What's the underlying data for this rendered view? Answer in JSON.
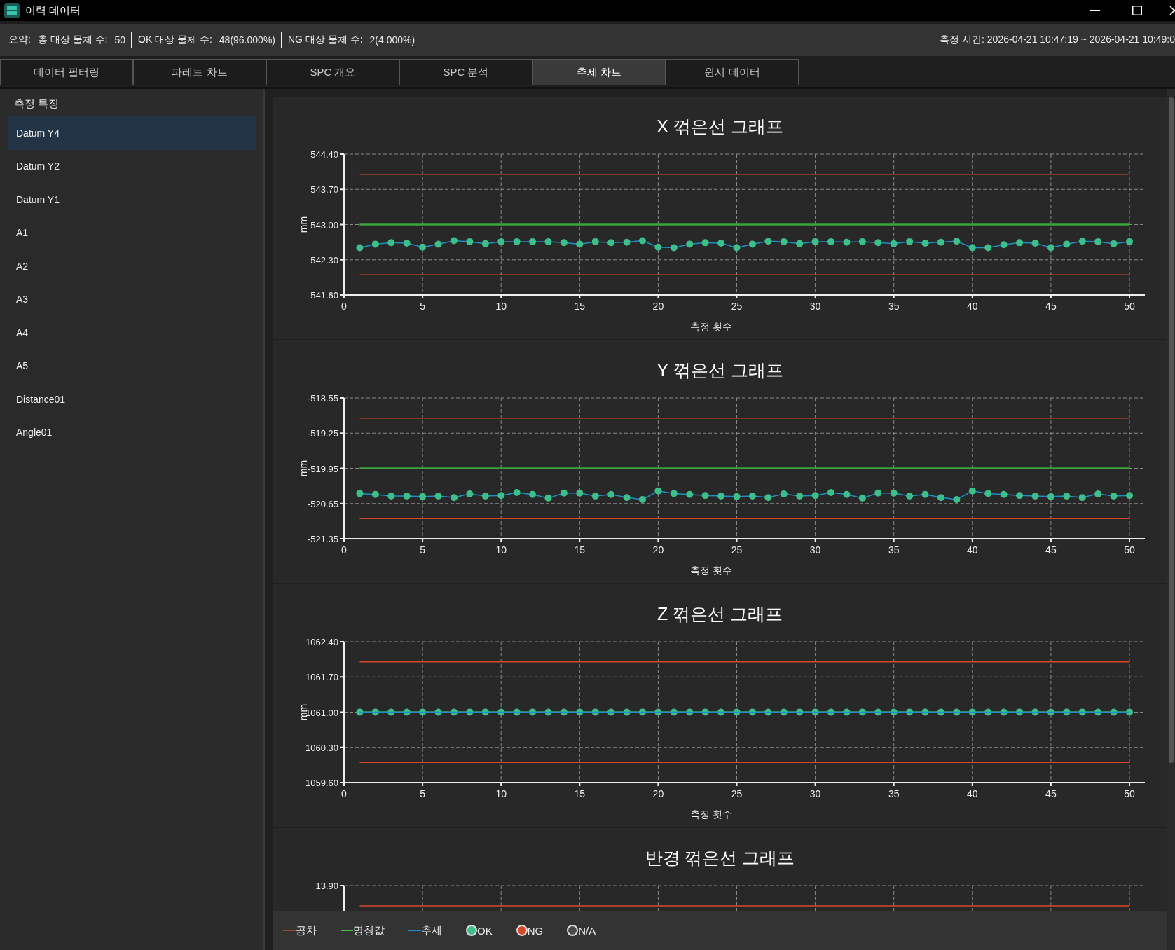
{
  "window": {
    "title": "이력 데이터"
  },
  "summary": {
    "label": "요약:",
    "stats": [
      {
        "label": "총 대상 물체 수:",
        "value": "50"
      },
      {
        "label": "OK 대상 물체 수:",
        "value": "48(96.000%)"
      },
      {
        "label": "NG 대상 물체 수:",
        "value": "2(4.000%)"
      }
    ],
    "time": "측정 시간: 2026-04-21 10:47:19 ~ 2026-04-21 10:49:0"
  },
  "tabs": [
    {
      "label": "데이터 필터링",
      "selected": false
    },
    {
      "label": "파레토 차트",
      "selected": false
    },
    {
      "label": "SPC 개요",
      "selected": false
    },
    {
      "label": "SPC 분석",
      "selected": false
    },
    {
      "label": "추세 차트",
      "selected": true
    },
    {
      "label": "원시 데이터",
      "selected": false
    }
  ],
  "sidebar": {
    "header": "측정 특징",
    "items": [
      {
        "label": "Datum Y4",
        "selected": true
      },
      {
        "label": "Datum Y2",
        "selected": false
      },
      {
        "label": "Datum Y1",
        "selected": false
      },
      {
        "label": "A1",
        "selected": false
      },
      {
        "label": "A2",
        "selected": false
      },
      {
        "label": "A3",
        "selected": false
      },
      {
        "label": "A4",
        "selected": false
      },
      {
        "label": "A5",
        "selected": false
      },
      {
        "label": "Distance01",
        "selected": false
      },
      {
        "label": "Angle01",
        "selected": false
      }
    ]
  },
  "charts": [
    {
      "chart_data": {
        "type": "line",
        "grid": true,
        "title": "X 꺾은선 그래프",
        "xlabel": "측정 횟수",
        "ylabel": "mm",
        "xlim": [
          0,
          50
        ],
        "ylim": [
          541.6,
          544.4
        ],
        "xticks": [
          0,
          5,
          10,
          15,
          20,
          25,
          30,
          35,
          40,
          45,
          50
        ],
        "yticks": [
          {
            "value": 541.6,
            "label": "541.60"
          },
          {
            "value": 542.3,
            "label": "542.30"
          },
          {
            "value": 543.0,
            "label": "543.00"
          },
          {
            "value": 543.7,
            "label": "543.70"
          },
          {
            "value": 544.4,
            "label": "544.40"
          }
        ],
        "x": [
          1,
          2,
          3,
          4,
          5,
          6,
          7,
          8,
          9,
          10,
          11,
          12,
          13,
          14,
          15,
          16,
          17,
          18,
          19,
          20,
          21,
          22,
          23,
          24,
          25,
          26,
          27,
          28,
          29,
          30,
          31,
          32,
          33,
          34,
          35,
          36,
          37,
          38,
          39,
          40,
          41,
          42,
          43,
          44,
          45,
          46,
          47,
          48,
          49,
          50
        ],
        "series": [
          {
            "color": "#d9472b",
            "values": [
              544.0,
              544.0,
              544.0,
              544.0,
              544.0,
              544.0,
              544.0,
              544.0,
              544.0,
              544.0,
              544.0,
              544.0,
              544.0,
              544.0,
              544.0,
              544.0,
              544.0,
              544.0,
              544.0,
              544.0,
              544.0,
              544.0,
              544.0,
              544.0,
              544.0,
              544.0,
              544.0,
              544.0,
              544.0,
              544.0,
              544.0,
              544.0,
              544.0,
              544.0,
              544.0,
              544.0,
              544.0,
              544.0,
              544.0,
              544.0,
              544.0,
              544.0,
              544.0,
              544.0,
              544.0,
              544.0,
              544.0,
              544.0,
              544.0,
              544.0
            ]
          },
          {
            "color": "#d9472b",
            "values": [
              542.0,
              542.0,
              542.0,
              542.0,
              542.0,
              542.0,
              542.0,
              542.0,
              542.0,
              542.0,
              542.0,
              542.0,
              542.0,
              542.0,
              542.0,
              542.0,
              542.0,
              542.0,
              542.0,
              542.0,
              542.0,
              542.0,
              542.0,
              542.0,
              542.0,
              542.0,
              542.0,
              542.0,
              542.0,
              542.0,
              542.0,
              542.0,
              542.0,
              542.0,
              542.0,
              542.0,
              542.0,
              542.0,
              542.0,
              542.0,
              542.0,
              542.0,
              542.0,
              542.0,
              542.0,
              542.0,
              542.0,
              542.0,
              542.0,
              542.0
            ]
          },
          {
            "color": "#3aa63a",
            "values": [
              543.0,
              543.0,
              543.0,
              543.0,
              543.0,
              543.0,
              543.0,
              543.0,
              543.0,
              543.0,
              543.0,
              543.0,
              543.0,
              543.0,
              543.0,
              543.0,
              543.0,
              543.0,
              543.0,
              543.0,
              543.0,
              543.0,
              543.0,
              543.0,
              543.0,
              543.0,
              543.0,
              543.0,
              543.0,
              543.0,
              543.0,
              543.0,
              543.0,
              543.0,
              543.0,
              543.0,
              543.0,
              543.0,
              543.0,
              543.0,
              543.0,
              543.0,
              543.0,
              543.0,
              543.0,
              543.0,
              543.0,
              543.0,
              543.0,
              543.0
            ]
          },
          {
            "color": "#1f8fc8",
            "marker": "circle",
            "values": [
              542.54,
              542.61,
              542.64,
              542.63,
              542.55,
              542.61,
              542.68,
              542.66,
              542.62,
              542.66,
              542.66,
              542.66,
              542.66,
              542.64,
              542.61,
              542.66,
              542.64,
              542.65,
              542.68,
              542.55,
              542.54,
              542.61,
              542.64,
              542.63,
              542.54,
              542.61,
              542.67,
              542.66,
              542.62,
              542.66,
              542.66,
              542.65,
              542.66,
              542.64,
              542.62,
              542.66,
              542.63,
              542.65,
              542.67,
              542.54,
              542.54,
              542.6,
              542.64,
              542.63,
              542.54,
              542.61,
              542.67,
              542.66,
              542.62,
              542.66
            ]
          }
        ]
      }
    },
    {
      "chart_data": {
        "type": "line",
        "grid": true,
        "title": "Y 꺾은선 그래프",
        "xlabel": "측정 횟수",
        "ylabel": "mm",
        "xlim": [
          0,
          50
        ],
        "ylim": [
          -521.35,
          -518.55
        ],
        "xticks": [
          0,
          5,
          10,
          15,
          20,
          25,
          30,
          35,
          40,
          45,
          50
        ],
        "yticks": [
          {
            "value": -521.35,
            "label": "-521.35"
          },
          {
            "value": -520.65,
            "label": "-520.65"
          },
          {
            "value": -519.95,
            "label": "-519.95"
          },
          {
            "value": -519.25,
            "label": "-519.25"
          },
          {
            "value": -518.55,
            "label": "-518.55"
          }
        ],
        "x": [
          1,
          2,
          3,
          4,
          5,
          6,
          7,
          8,
          9,
          10,
          11,
          12,
          13,
          14,
          15,
          16,
          17,
          18,
          19,
          20,
          21,
          22,
          23,
          24,
          25,
          26,
          27,
          28,
          29,
          30,
          31,
          32,
          33,
          34,
          35,
          36,
          37,
          38,
          39,
          40,
          41,
          42,
          43,
          44,
          45,
          46,
          47,
          48,
          49,
          50
        ],
        "series": [
          {
            "color": "#d9472b",
            "values": [
              -518.95,
              -518.95,
              -518.95,
              -518.95,
              -518.95,
              -518.95,
              -518.95,
              -518.95,
              -518.95,
              -518.95,
              -518.95,
              -518.95,
              -518.95,
              -518.95,
              -518.95,
              -518.95,
              -518.95,
              -518.95,
              -518.95,
              -518.95,
              -518.95,
              -518.95,
              -518.95,
              -518.95,
              -518.95,
              -518.95,
              -518.95,
              -518.95,
              -518.95,
              -518.95,
              -518.95,
              -518.95,
              -518.95,
              -518.95,
              -518.95,
              -518.95,
              -518.95,
              -518.95,
              -518.95,
              -518.95,
              -518.95,
              -518.95,
              -518.95,
              -518.95,
              -518.95,
              -518.95,
              -518.95,
              -518.95,
              -518.95,
              -518.95
            ]
          },
          {
            "color": "#d9472b",
            "values": [
              -520.95,
              -520.95,
              -520.95,
              -520.95,
              -520.95,
              -520.95,
              -520.95,
              -520.95,
              -520.95,
              -520.95,
              -520.95,
              -520.95,
              -520.95,
              -520.95,
              -520.95,
              -520.95,
              -520.95,
              -520.95,
              -520.95,
              -520.95,
              -520.95,
              -520.95,
              -520.95,
              -520.95,
              -520.95,
              -520.95,
              -520.95,
              -520.95,
              -520.95,
              -520.95,
              -520.95,
              -520.95,
              -520.95,
              -520.95,
              -520.95,
              -520.95,
              -520.95,
              -520.95,
              -520.95,
              -520.95,
              -520.95,
              -520.95,
              -520.95,
              -520.95,
              -520.95,
              -520.95,
              -520.95,
              -520.95,
              -520.95,
              -520.95
            ]
          },
          {
            "color": "#3aa63a",
            "values": [
              -519.95,
              -519.95,
              -519.95,
              -519.95,
              -519.95,
              -519.95,
              -519.95,
              -519.95,
              -519.95,
              -519.95,
              -519.95,
              -519.95,
              -519.95,
              -519.95,
              -519.95,
              -519.95,
              -519.95,
              -519.95,
              -519.95,
              -519.95,
              -519.95,
              -519.95,
              -519.95,
              -519.95,
              -519.95,
              -519.95,
              -519.95,
              -519.95,
              -519.95,
              -519.95,
              -519.95,
              -519.95,
              -519.95,
              -519.95,
              -519.95,
              -519.95,
              -519.95,
              -519.95,
              -519.95,
              -519.95,
              -519.95,
              -519.95,
              -519.95,
              -519.95,
              -519.95,
              -519.95,
              -519.95,
              -519.95,
              -519.95,
              -519.95
            ]
          },
          {
            "color": "#1f8fc8",
            "marker": "circle",
            "values": [
              -520.45,
              -520.47,
              -520.5,
              -520.5,
              -520.51,
              -520.5,
              -520.53,
              -520.46,
              -520.5,
              -520.49,
              -520.43,
              -520.47,
              -520.54,
              -520.44,
              -520.44,
              -520.5,
              -520.47,
              -520.53,
              -520.57,
              -520.4,
              -520.45,
              -520.47,
              -520.49,
              -520.5,
              -520.51,
              -520.5,
              -520.53,
              -520.46,
              -520.5,
              -520.49,
              -520.43,
              -520.47,
              -520.54,
              -520.44,
              -520.44,
              -520.5,
              -520.47,
              -520.53,
              -520.57,
              -520.4,
              -520.45,
              -520.47,
              -520.49,
              -520.5,
              -520.51,
              -520.5,
              -520.53,
              -520.46,
              -520.5,
              -520.49
            ]
          }
        ]
      }
    },
    {
      "chart_data": {
        "type": "line",
        "grid": true,
        "title": "Z 꺾은선 그래프",
        "xlabel": "측정 횟수",
        "ylabel": "mm",
        "xlim": [
          0,
          50
        ],
        "ylim": [
          1059.6,
          1062.4
        ],
        "xticks": [
          0,
          5,
          10,
          15,
          20,
          25,
          30,
          35,
          40,
          45,
          50
        ],
        "yticks": [
          {
            "value": 1059.6,
            "label": "1059.60"
          },
          {
            "value": 1060.3,
            "label": "1060.30"
          },
          {
            "value": 1061.0,
            "label": "1061.00"
          },
          {
            "value": 1061.7,
            "label": "1061.70"
          },
          {
            "value": 1062.4,
            "label": "1062.40"
          }
        ],
        "x": [
          1,
          2,
          3,
          4,
          5,
          6,
          7,
          8,
          9,
          10,
          11,
          12,
          13,
          14,
          15,
          16,
          17,
          18,
          19,
          20,
          21,
          22,
          23,
          24,
          25,
          26,
          27,
          28,
          29,
          30,
          31,
          32,
          33,
          34,
          35,
          36,
          37,
          38,
          39,
          40,
          41,
          42,
          43,
          44,
          45,
          46,
          47,
          48,
          49,
          50
        ],
        "series": [
          {
            "color": "#d9472b",
            "values": [
              1062.0,
              1062.0,
              1062.0,
              1062.0,
              1062.0,
              1062.0,
              1062.0,
              1062.0,
              1062.0,
              1062.0,
              1062.0,
              1062.0,
              1062.0,
              1062.0,
              1062.0,
              1062.0,
              1062.0,
              1062.0,
              1062.0,
              1062.0,
              1062.0,
              1062.0,
              1062.0,
              1062.0,
              1062.0,
              1062.0,
              1062.0,
              1062.0,
              1062.0,
              1062.0,
              1062.0,
              1062.0,
              1062.0,
              1062.0,
              1062.0,
              1062.0,
              1062.0,
              1062.0,
              1062.0,
              1062.0,
              1062.0,
              1062.0,
              1062.0,
              1062.0,
              1062.0,
              1062.0,
              1062.0,
              1062.0,
              1062.0,
              1062.0
            ]
          },
          {
            "color": "#d9472b",
            "values": [
              1060.0,
              1060.0,
              1060.0,
              1060.0,
              1060.0,
              1060.0,
              1060.0,
              1060.0,
              1060.0,
              1060.0,
              1060.0,
              1060.0,
              1060.0,
              1060.0,
              1060.0,
              1060.0,
              1060.0,
              1060.0,
              1060.0,
              1060.0,
              1060.0,
              1060.0,
              1060.0,
              1060.0,
              1060.0,
              1060.0,
              1060.0,
              1060.0,
              1060.0,
              1060.0,
              1060.0,
              1060.0,
              1060.0,
              1060.0,
              1060.0,
              1060.0,
              1060.0,
              1060.0,
              1060.0,
              1060.0,
              1060.0,
              1060.0,
              1060.0,
              1060.0,
              1060.0,
              1060.0,
              1060.0,
              1060.0,
              1060.0,
              1060.0
            ]
          },
          {
            "color": "#3aa63a",
            "marker": "circle",
            "values": [
              1061.0,
              1061.0,
              1061.0,
              1061.0,
              1061.0,
              1061.0,
              1061.0,
              1061.0,
              1061.0,
              1061.0,
              1061.0,
              1061.0,
              1061.0,
              1061.0,
              1061.0,
              1061.0,
              1061.0,
              1061.0,
              1061.0,
              1061.0,
              1061.0,
              1061.0,
              1061.0,
              1061.0,
              1061.0,
              1061.0,
              1061.0,
              1061.0,
              1061.0,
              1061.0,
              1061.0,
              1061.0,
              1061.0,
              1061.0,
              1061.0,
              1061.0,
              1061.0,
              1061.0,
              1061.0,
              1061.0,
              1061.0,
              1061.0,
              1061.0,
              1061.0,
              1061.0,
              1061.0,
              1061.0,
              1061.0,
              1061.0,
              1061.0
            ]
          },
          {
            "color": "#1f8fc8",
            "values": [
              1061.0,
              1061.0,
              1061.0,
              1061.0,
              1061.0,
              1061.0,
              1061.0,
              1061.0,
              1061.0,
              1061.0,
              1061.0,
              1061.0,
              1061.0,
              1061.0,
              1061.0,
              1061.0,
              1061.0,
              1061.0,
              1061.0,
              1061.0,
              1061.0,
              1061.0,
              1061.0,
              1061.0,
              1061.0,
              1061.0,
              1061.0,
              1061.0,
              1061.0,
              1061.0,
              1061.0,
              1061.0,
              1061.0,
              1061.0,
              1061.0,
              1061.0,
              1061.0,
              1061.0,
              1061.0,
              1061.0,
              1061.0,
              1061.0,
              1061.0,
              1061.0,
              1061.0,
              1061.0,
              1061.0,
              1061.0,
              1061.0,
              1061.0
            ]
          }
        ]
      }
    }
  ],
  "partial_chart": {
    "title": "반경 꺾은선 그래프",
    "top_ytick": "13.90"
  },
  "legend": [
    {
      "kind": "line",
      "label": "공차",
      "color": "#a0442c"
    },
    {
      "kind": "line",
      "label": "명칭값",
      "color": "#3ec43e"
    },
    {
      "kind": "line",
      "label": "추세",
      "color": "#1f8fc8"
    },
    {
      "kind": "dot",
      "label": "OK",
      "color": "#3dbf8a"
    },
    {
      "kind": "dot",
      "label": "NG",
      "color": "#d9472b"
    },
    {
      "kind": "dot",
      "label": "N/A",
      "color": "#4a4a4a"
    }
  ]
}
